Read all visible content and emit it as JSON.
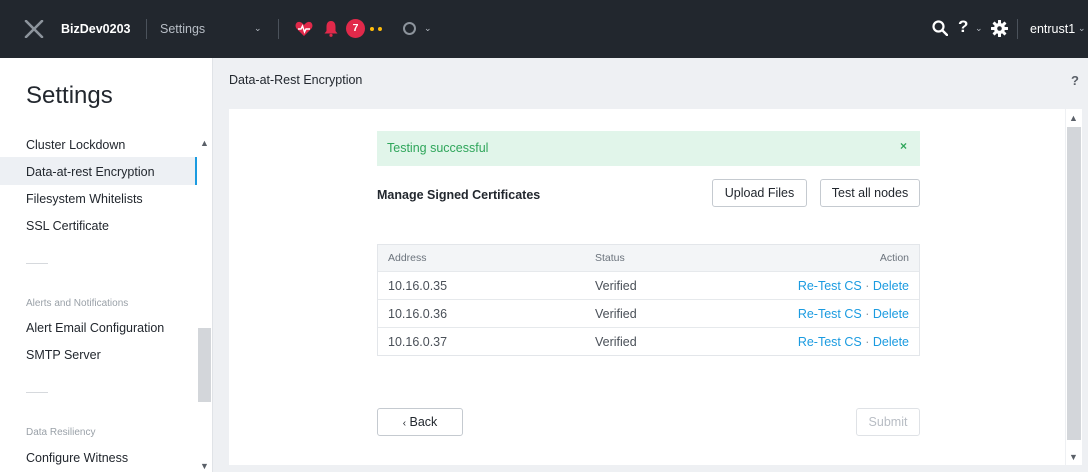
{
  "topbar": {
    "cluster_name": "BizDev0203",
    "section": "Settings",
    "alert_count": "7",
    "help_label": "?",
    "username": "entrust1",
    "icons": [
      "nutanix-logo-icon",
      "health-heart-icon",
      "alert-bell-icon",
      "tasks-dots-icon",
      "status-circle-icon",
      "search-icon",
      "help-icon",
      "gear-icon"
    ]
  },
  "sidebar": {
    "title": "Settings",
    "items": [
      {
        "label": "Cluster Lockdown"
      },
      {
        "label": "Data-at-rest Encryption"
      },
      {
        "label": "Filesystem Whitelists"
      },
      {
        "label": "SSL Certificate"
      }
    ],
    "alerts_section": "Alerts and Notifications",
    "alerts_items": [
      {
        "label": "Alert Email Configuration"
      },
      {
        "label": "SMTP Server"
      }
    ],
    "resiliency_section": "Data Resiliency",
    "resiliency_items": [
      {
        "label": "Configure Witness"
      }
    ]
  },
  "page": {
    "title": "Data-at-Rest Encryption",
    "help": "?",
    "alert_text": "Testing successful",
    "alert_close": "×",
    "section_label": "Manage Signed Certificates",
    "upload_button": "Upload Files",
    "test_button": "Test all nodes",
    "back_button": "Back",
    "submit_button": "Submit"
  },
  "table": {
    "headers": {
      "address": "Address",
      "status": "Status",
      "action": "Action"
    },
    "rows": [
      {
        "address": "10.16.0.35",
        "status": "Verified",
        "retest": "Re-Test CS",
        "sep": "·",
        "delete": "Delete"
      },
      {
        "address": "10.16.0.36",
        "status": "Verified",
        "retest": "Re-Test CS",
        "sep": "·",
        "delete": "Delete"
      },
      {
        "address": "10.16.0.37",
        "status": "Verified",
        "retest": "Re-Test CS",
        "sep": "·",
        "delete": "Delete"
      }
    ]
  },
  "colors": {
    "topbar": "#22272e",
    "accent": "#1b9be0",
    "success": "#2fa65b",
    "alert_badge": "#e1294a",
    "health": "#e1294a",
    "task_dots": "#ffbc0b"
  }
}
